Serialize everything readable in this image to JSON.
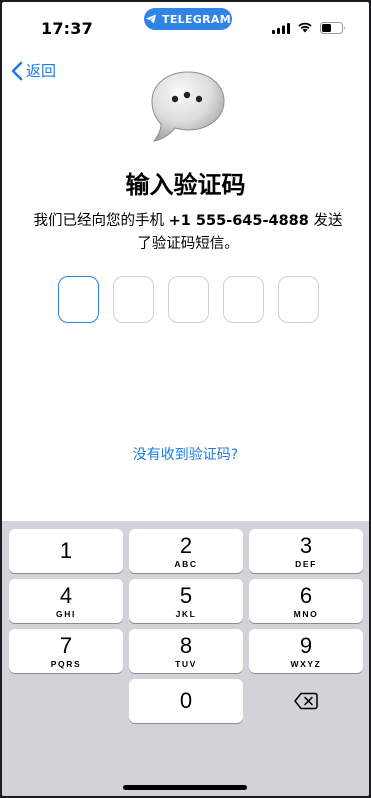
{
  "status_bar": {
    "time": "17:37",
    "app_pill": "TELEGRAM",
    "icons": [
      "signal-icon",
      "wifi-icon",
      "battery-icon"
    ]
  },
  "nav": {
    "back_label": "返回"
  },
  "main": {
    "title": "输入验证码",
    "subtitle_prefix": "我们已经向您的手机 ",
    "phone": "+1 555-645-4888",
    "subtitle_suffix": " 发送了验证码短信。",
    "code_boxes": 5,
    "resend_label": "没有收到验证码?"
  },
  "keyboard": {
    "keys": [
      {
        "num": "1",
        "letters": ""
      },
      {
        "num": "2",
        "letters": "ABC"
      },
      {
        "num": "3",
        "letters": "DEF"
      },
      {
        "num": "4",
        "letters": "GHI"
      },
      {
        "num": "5",
        "letters": "JKL"
      },
      {
        "num": "6",
        "letters": "MNO"
      },
      {
        "num": "7",
        "letters": "PQRS"
      },
      {
        "num": "8",
        "letters": "TUV"
      },
      {
        "num": "9",
        "letters": "WXYZ"
      },
      {
        "num": "0",
        "letters": ""
      }
    ]
  },
  "colors": {
    "accent": "#2f83e9",
    "link": "#1a7de3",
    "keyboard_bg": "#d1d3d9"
  }
}
